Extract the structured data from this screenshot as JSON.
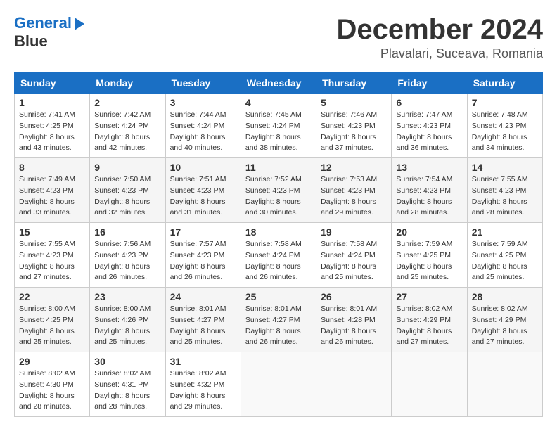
{
  "header": {
    "logo_line1": "General",
    "logo_line2": "Blue",
    "month_title": "December 2024",
    "location": "Plavalari, Suceava, Romania"
  },
  "days_of_week": [
    "Sunday",
    "Monday",
    "Tuesday",
    "Wednesday",
    "Thursday",
    "Friday",
    "Saturday"
  ],
  "weeks": [
    [
      {
        "day": "1",
        "sunrise": "7:41 AM",
        "sunset": "4:25 PM",
        "daylight": "8 hours and 43 minutes."
      },
      {
        "day": "2",
        "sunrise": "7:42 AM",
        "sunset": "4:24 PM",
        "daylight": "8 hours and 42 minutes."
      },
      {
        "day": "3",
        "sunrise": "7:44 AM",
        "sunset": "4:24 PM",
        "daylight": "8 hours and 40 minutes."
      },
      {
        "day": "4",
        "sunrise": "7:45 AM",
        "sunset": "4:24 PM",
        "daylight": "8 hours and 38 minutes."
      },
      {
        "day": "5",
        "sunrise": "7:46 AM",
        "sunset": "4:23 PM",
        "daylight": "8 hours and 37 minutes."
      },
      {
        "day": "6",
        "sunrise": "7:47 AM",
        "sunset": "4:23 PM",
        "daylight": "8 hours and 36 minutes."
      },
      {
        "day": "7",
        "sunrise": "7:48 AM",
        "sunset": "4:23 PM",
        "daylight": "8 hours and 34 minutes."
      }
    ],
    [
      {
        "day": "8",
        "sunrise": "7:49 AM",
        "sunset": "4:23 PM",
        "daylight": "8 hours and 33 minutes."
      },
      {
        "day": "9",
        "sunrise": "7:50 AM",
        "sunset": "4:23 PM",
        "daylight": "8 hours and 32 minutes."
      },
      {
        "day": "10",
        "sunrise": "7:51 AM",
        "sunset": "4:23 PM",
        "daylight": "8 hours and 31 minutes."
      },
      {
        "day": "11",
        "sunrise": "7:52 AM",
        "sunset": "4:23 PM",
        "daylight": "8 hours and 30 minutes."
      },
      {
        "day": "12",
        "sunrise": "7:53 AM",
        "sunset": "4:23 PM",
        "daylight": "8 hours and 29 minutes."
      },
      {
        "day": "13",
        "sunrise": "7:54 AM",
        "sunset": "4:23 PM",
        "daylight": "8 hours and 28 minutes."
      },
      {
        "day": "14",
        "sunrise": "7:55 AM",
        "sunset": "4:23 PM",
        "daylight": "8 hours and 28 minutes."
      }
    ],
    [
      {
        "day": "15",
        "sunrise": "7:55 AM",
        "sunset": "4:23 PM",
        "daylight": "8 hours and 27 minutes."
      },
      {
        "day": "16",
        "sunrise": "7:56 AM",
        "sunset": "4:23 PM",
        "daylight": "8 hours and 26 minutes."
      },
      {
        "day": "17",
        "sunrise": "7:57 AM",
        "sunset": "4:23 PM",
        "daylight": "8 hours and 26 minutes."
      },
      {
        "day": "18",
        "sunrise": "7:58 AM",
        "sunset": "4:24 PM",
        "daylight": "8 hours and 26 minutes."
      },
      {
        "day": "19",
        "sunrise": "7:58 AM",
        "sunset": "4:24 PM",
        "daylight": "8 hours and 25 minutes."
      },
      {
        "day": "20",
        "sunrise": "7:59 AM",
        "sunset": "4:25 PM",
        "daylight": "8 hours and 25 minutes."
      },
      {
        "day": "21",
        "sunrise": "7:59 AM",
        "sunset": "4:25 PM",
        "daylight": "8 hours and 25 minutes."
      }
    ],
    [
      {
        "day": "22",
        "sunrise": "8:00 AM",
        "sunset": "4:25 PM",
        "daylight": "8 hours and 25 minutes."
      },
      {
        "day": "23",
        "sunrise": "8:00 AM",
        "sunset": "4:26 PM",
        "daylight": "8 hours and 25 minutes."
      },
      {
        "day": "24",
        "sunrise": "8:01 AM",
        "sunset": "4:27 PM",
        "daylight": "8 hours and 25 minutes."
      },
      {
        "day": "25",
        "sunrise": "8:01 AM",
        "sunset": "4:27 PM",
        "daylight": "8 hours and 26 minutes."
      },
      {
        "day": "26",
        "sunrise": "8:01 AM",
        "sunset": "4:28 PM",
        "daylight": "8 hours and 26 minutes."
      },
      {
        "day": "27",
        "sunrise": "8:02 AM",
        "sunset": "4:29 PM",
        "daylight": "8 hours and 27 minutes."
      },
      {
        "day": "28",
        "sunrise": "8:02 AM",
        "sunset": "4:29 PM",
        "daylight": "8 hours and 27 minutes."
      }
    ],
    [
      {
        "day": "29",
        "sunrise": "8:02 AM",
        "sunset": "4:30 PM",
        "daylight": "8 hours and 28 minutes."
      },
      {
        "day": "30",
        "sunrise": "8:02 AM",
        "sunset": "4:31 PM",
        "daylight": "8 hours and 28 minutes."
      },
      {
        "day": "31",
        "sunrise": "8:02 AM",
        "sunset": "4:32 PM",
        "daylight": "8 hours and 29 minutes."
      },
      null,
      null,
      null,
      null
    ]
  ]
}
